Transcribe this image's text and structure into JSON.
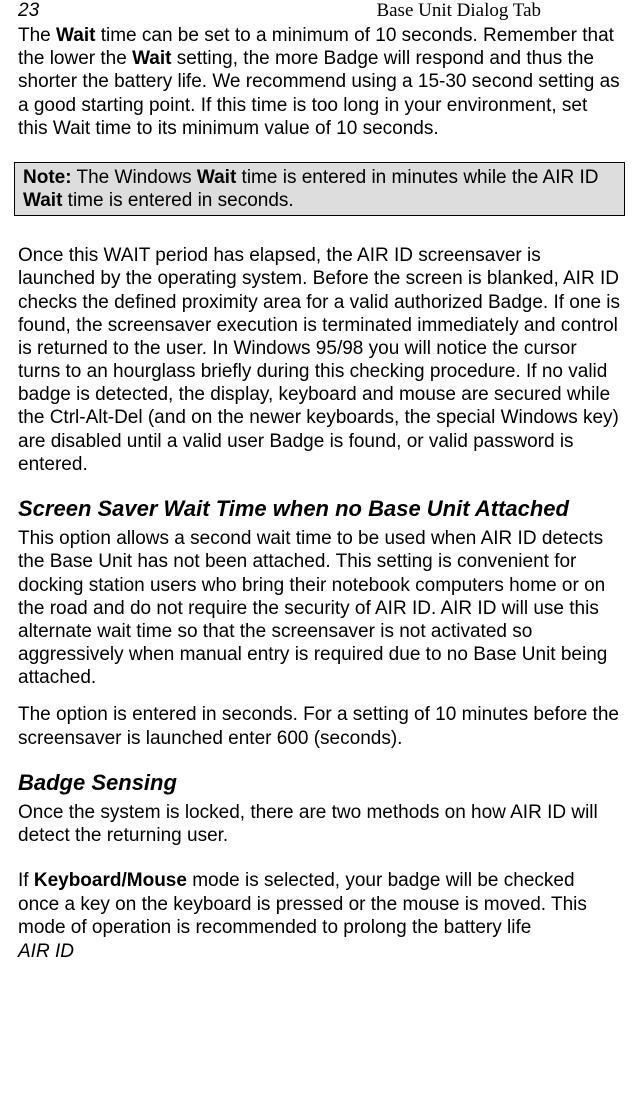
{
  "header": {
    "page_number": "23",
    "title": "Base Unit Dialog Tab"
  },
  "para1": {
    "t1": "The ",
    "b1": "Wait",
    "t2": " time can be set to a minimum of 10 seconds. Remember that the lower the ",
    "b2": "Wait",
    "t3": " setting, the more Badge will respond and thus the shorter the battery life.  We recommend using a 15-30 second setting as a good starting point. If this time is too long in your environment, set this Wait time to its minimum value of 10 seconds."
  },
  "note": {
    "b1": "Note:",
    "t1": " The Windows ",
    "b2": "Wait",
    "t2": " time is entered in minutes while the AIR ID ",
    "b3": "Wait",
    "t3": " time is entered in seconds."
  },
  "para2": "Once this WAIT period has elapsed, the AIR ID screensaver is launched by the operating system.  Before the screen is blanked, AIR ID checks the defined proximity area for a valid authorized Badge.  If one is found, the screensaver execution is terminated immediately and control is returned to the user.  In Windows 95/98 you will notice the cursor turns to an hourglass briefly during this checking procedure.  If no valid badge is detected, the display, keyboard and mouse are secured while the Ctrl-Alt-Del (and on the newer keyboards, the special Windows key) are disabled until a valid user Badge is found, or valid password is entered.",
  "heading1": "Screen Saver Wait Time when no Base Unit Attached",
  "para3": "This option allows a second wait time to be used when AIR ID detects the Base Unit has not been attached. This setting is convenient for docking station users who bring their notebook computers home or on the road and do not require the security of AIR ID. AIR ID will use this alternate wait time so that the screensaver is not activated so aggressively when manual entry is required due to no Base Unit being attached.",
  "para4": "The option is entered in seconds. For a setting of 10 minutes before the screensaver is launched enter 600 (seconds).",
  "heading2": "Badge Sensing",
  "para5": "Once the system is locked, there are two methods on how AIR ID will detect the returning user.",
  "para6": {
    "t1": "If ",
    "b1": "Keyboard/Mouse",
    "t2": " mode is selected, your badge will be checked once a key on the keyboard is pressed or the mouse is moved. This mode of operation is recommended to prolong the battery life"
  },
  "footer": "AIR ID"
}
